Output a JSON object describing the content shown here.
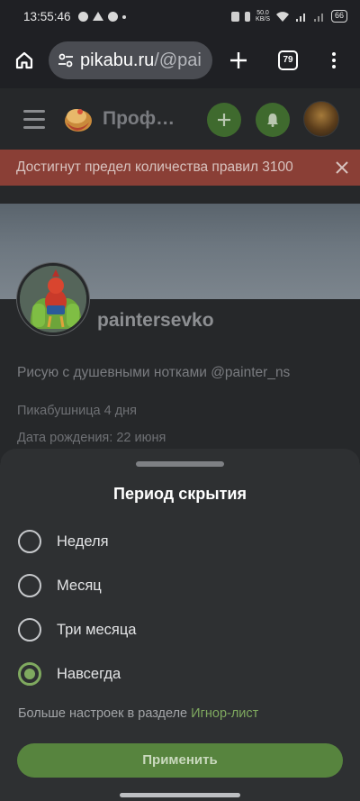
{
  "status_bar": {
    "time": "13:55:46",
    "network_speed_value": "50.0",
    "network_speed_unit": "KB/S",
    "battery": "66"
  },
  "browser": {
    "url_host": "pikabu.ru",
    "url_path": "/@pai",
    "tab_count": "79",
    "icons": [
      "home-icon",
      "tune-icon",
      "plus-icon",
      "tabs-icon",
      "more-vert-icon"
    ]
  },
  "site_header": {
    "title": "Проф…",
    "icons": [
      "hamburger-icon",
      "logo",
      "add-icon",
      "bell-icon",
      "avatar"
    ],
    "accent": "#3f6a2e"
  },
  "alert": {
    "text": "Достигнут предел количества правил 3100",
    "color": "#8a3f36"
  },
  "profile": {
    "username": "paintersevko",
    "bio": "Рисую с душевными нотками @painter_ns",
    "tenure": "Пикабушница 4 дня",
    "birthday": "Дата рождения: 22 июня"
  },
  "sheet": {
    "title": "Период скрытия",
    "options": [
      {
        "label": "Неделя",
        "selected": false
      },
      {
        "label": "Месяц",
        "selected": false
      },
      {
        "label": "Три месяца",
        "selected": false
      },
      {
        "label": "Навсегда",
        "selected": true
      }
    ],
    "note_text": "Больше настроек в разделе ",
    "note_link": "Игнор-лист",
    "apply_label": "Применить",
    "accent": "#7fa95f"
  }
}
